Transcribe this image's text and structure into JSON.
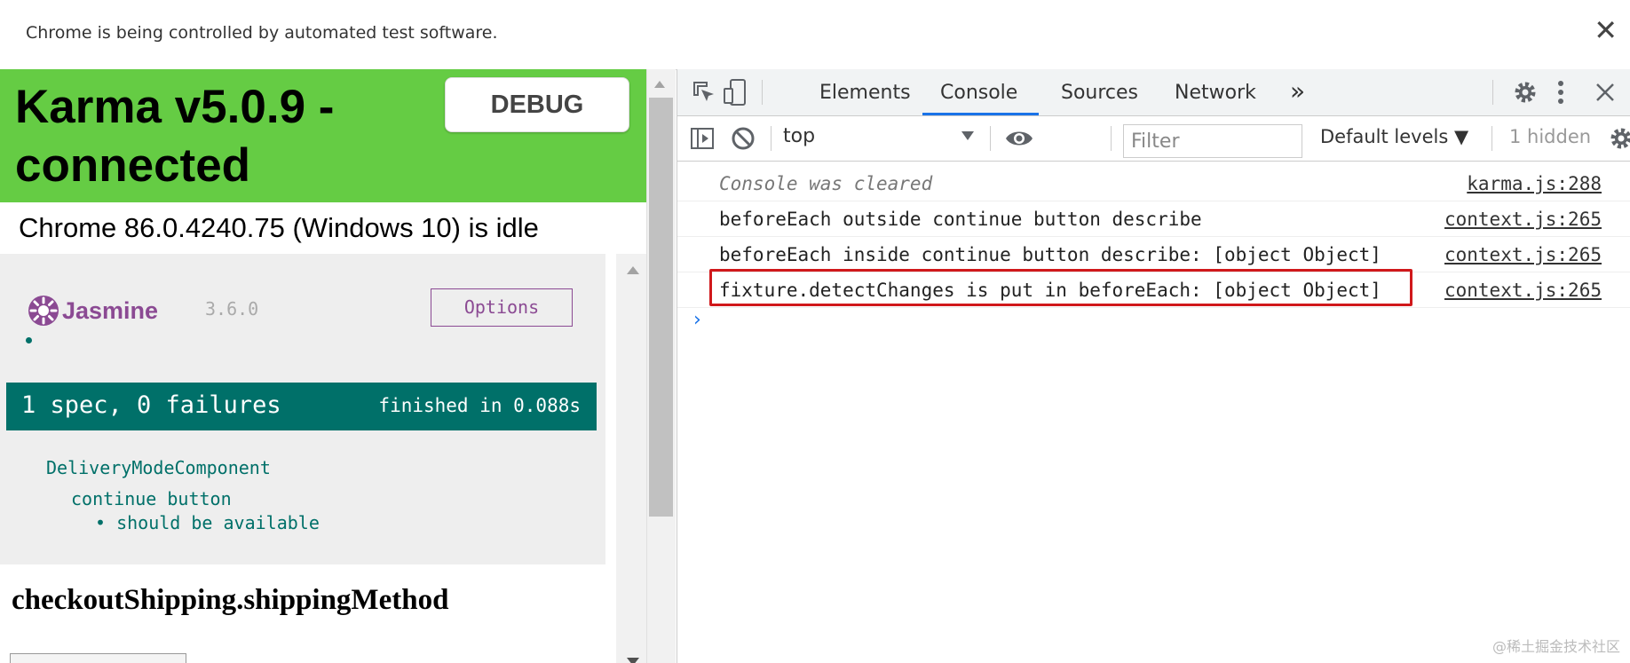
{
  "infobar": {
    "message": "Chrome is being controlled by automated test software.",
    "close_glyph": "✕"
  },
  "karma": {
    "title": "Karma v5.0.9 - connected",
    "debug_label": "DEBUG",
    "browser_status": "Chrome 86.0.4240.75 (Windows 10) is idle",
    "banner_color": "#65cc44"
  },
  "jasmine": {
    "logo_text": "Jasmine",
    "version": "3.6.0",
    "options_label": "Options",
    "summary": "1 spec, 0 failures",
    "duration": "finished in 0.088s",
    "suites": [
      {
        "label": "DeliveryModeComponent"
      },
      {
        "label": "continue button"
      }
    ],
    "specs": [
      {
        "label": "should be available"
      }
    ],
    "accent_color": "#007069"
  },
  "page": {
    "heading": "checkoutShipping.shippingMethod"
  },
  "devtools": {
    "tabs": [
      {
        "label": "Elements"
      },
      {
        "label": "Console",
        "active": true
      },
      {
        "label": "Sources"
      },
      {
        "label": "Network"
      }
    ],
    "more_tabs_glyph": "»",
    "context": "top",
    "filter_placeholder": "Filter",
    "levels_label": "Default levels ▼",
    "hidden_count": "1 hidden",
    "messages": [
      {
        "text": "Console was cleared",
        "source": "karma.js:288",
        "style": "info-italic"
      },
      {
        "text": "beforeEach outside continue button describe",
        "source": "context.js:265"
      },
      {
        "text": "beforeEach inside continue button describe: [object Object]",
        "source": "context.js:265"
      },
      {
        "text": "fixture.detectChanges is put in beforeEach: [object Object]",
        "source": "context.js:265",
        "highlighted": true
      }
    ],
    "prompt_glyph": "›",
    "highlight_color": "#d0181b"
  },
  "watermark": "@稀土掘金技术社区"
}
